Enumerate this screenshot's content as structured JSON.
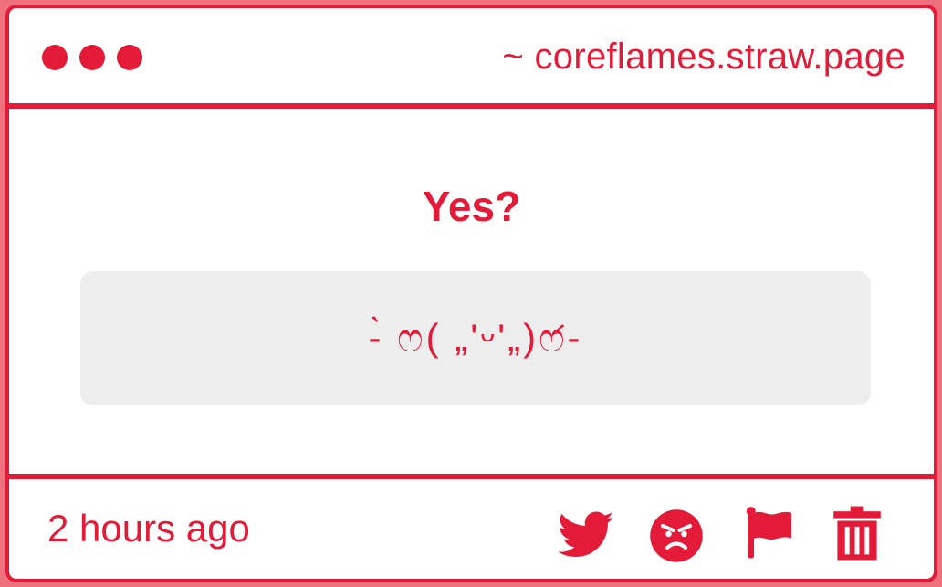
{
  "window": {
    "dots": [
      "dot",
      "dot",
      "dot"
    ],
    "site_url": "~ coreflames.straw.page"
  },
  "question": {
    "title": "Yes?",
    "answer": "-̀ ෆ( „'ᵕ'„)ෆ́-"
  },
  "footer": {
    "timestamp": "2 hours ago",
    "actions": [
      {
        "name": "twitter-share-icon",
        "label": "Share on Twitter"
      },
      {
        "name": "angry-face-icon",
        "label": "React"
      },
      {
        "name": "flag-icon",
        "label": "Report"
      },
      {
        "name": "trash-icon",
        "label": "Delete"
      }
    ]
  },
  "colors": {
    "accent": "#e31b38",
    "background": "#f0717e",
    "card": "#ffffff",
    "answer_box": "#eeeded"
  }
}
